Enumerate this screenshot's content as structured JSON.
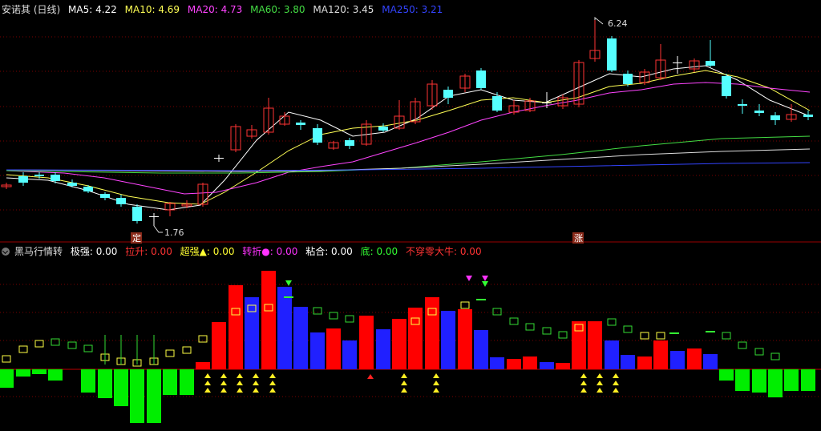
{
  "top": {
    "title": "安诺其 (日线)",
    "ma": [
      {
        "label": "MA5: 4.22",
        "color": "#ffffff"
      },
      {
        "label": "MA10: 4.69",
        "color": "#ffff55"
      },
      {
        "label": "MA20: 4.73",
        "color": "#ff44ff"
      },
      {
        "label": "MA60: 3.80",
        "color": "#44dd44"
      },
      {
        "label": "MA120: 3.45",
        "color": "#dddddd"
      },
      {
        "label": "MA250: 3.21",
        "color": "#3344ff"
      }
    ],
    "high_label": "6.24",
    "low_label": "1.76",
    "tag1": "定",
    "tag2": "涨"
  },
  "bottom": {
    "title": "黑马行情转",
    "fields": [
      {
        "label": "极强: 0.00",
        "color": "#ffffff"
      },
      {
        "label": "拉升: 0.00",
        "color": "#ff3333"
      },
      {
        "label": "超强▲: 0.00",
        "color": "#ffff33"
      },
      {
        "label": "转折●: 0.00",
        "color": "#ff33ff"
      },
      {
        "label": "粘合: 0.00",
        "color": "#ffffff"
      },
      {
        "label": "底: 0.00",
        "color": "#33ff33"
      },
      {
        "label": "不穿零大牛: 0.00",
        "color": "#ff3333"
      }
    ]
  },
  "colors": {
    "up": "#ff3333",
    "down": "#55ffff",
    "bar_up": "#ff0000",
    "bar_down": "#2020ff",
    "green": "#00ee00",
    "grid": "#7a0000"
  }
}
